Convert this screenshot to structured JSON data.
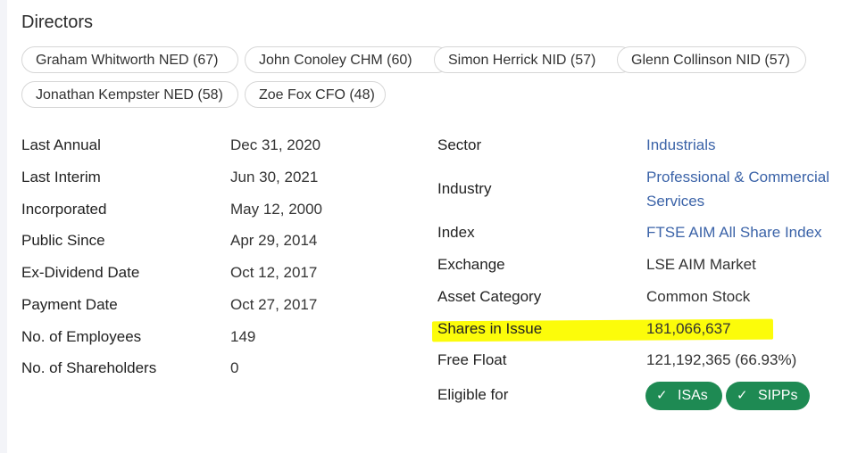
{
  "directors": {
    "title": "Directors",
    "chips": [
      "Graham Whitworth NED (67)",
      "John Conoley CHM (60)",
      "Simon Herrick NID (57)",
      "Glenn Collinson NID (57)",
      "Jonathan Kempster NED (58)",
      "Zoe Fox CFO (48)"
    ]
  },
  "left_info": [
    {
      "label": "Last Annual",
      "value": "Dec 31, 2020"
    },
    {
      "label": "Last Interim",
      "value": "Jun 30, 2021"
    },
    {
      "label": "Incorporated",
      "value": "May 12, 2000"
    },
    {
      "label": "Public Since",
      "value": "Apr 29, 2014"
    },
    {
      "label": "Ex-Dividend Date",
      "value": "Oct 12, 2017"
    },
    {
      "label": "Payment Date",
      "value": "Oct 27, 2017"
    },
    {
      "label": "No. of Employees",
      "value": "149"
    },
    {
      "label": "No. of Shareholders",
      "value": "0"
    }
  ],
  "right_info": {
    "sector": {
      "label": "Sector",
      "value": "Industrials"
    },
    "industry": {
      "label": "Industry",
      "value_line1": "Professional & Commercial",
      "value_line2": "Services"
    },
    "index": {
      "label": "Index",
      "value": "FTSE AIM All Share Index"
    },
    "exchange": {
      "label": "Exchange",
      "value": "LSE AIM Market"
    },
    "asset_category": {
      "label": "Asset Category",
      "value": "Common Stock"
    },
    "shares_in_issue": {
      "label": "Shares in Issue",
      "value": "181,066,637"
    },
    "free_float": {
      "label": "Free Float",
      "value": "121,192,365 (66.93%)"
    },
    "eligible_for": {
      "label": "Eligible for",
      "badges": [
        "ISAs",
        "SIPPs"
      ]
    }
  },
  "colors": {
    "link": "#3b63a8",
    "badge": "#1e8a53",
    "highlight": "#fcfc0a"
  },
  "icons": {
    "badge_check": "check-icon"
  }
}
